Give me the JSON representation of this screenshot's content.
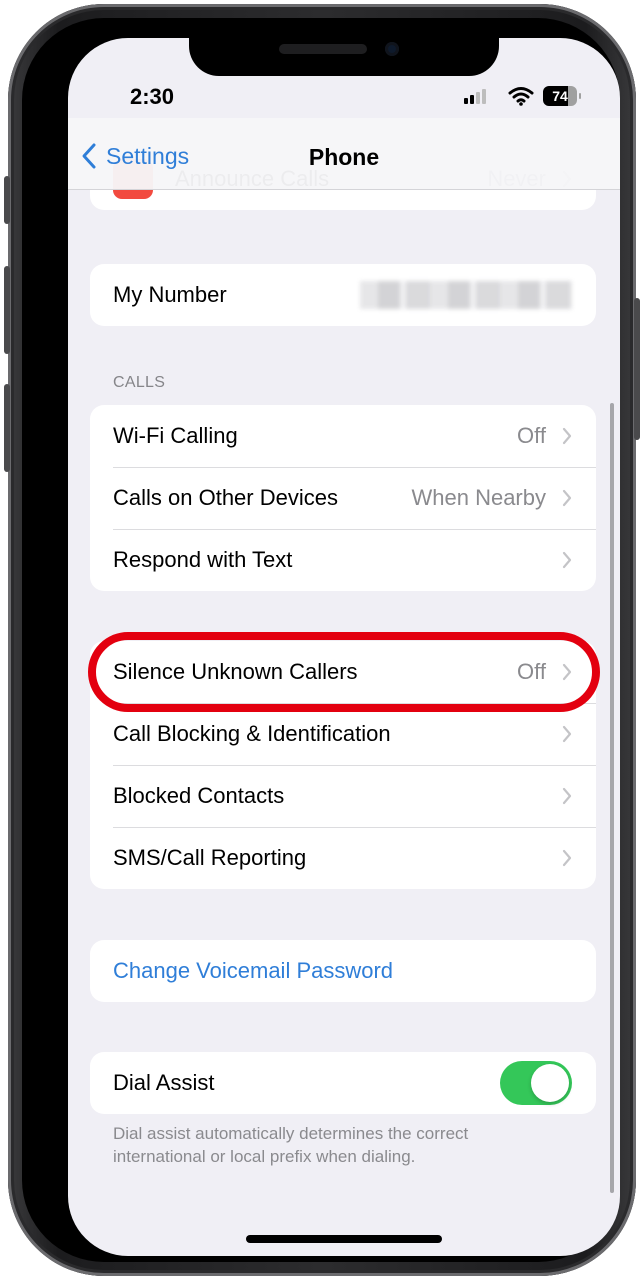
{
  "status_bar": {
    "time": "2:30",
    "battery_level": "74",
    "signal_bars_active": 2,
    "signal_bars_total": 4
  },
  "nav": {
    "back_label": "Settings",
    "title": "Phone"
  },
  "partial_row": {
    "label": "Announce Calls",
    "value": "Never",
    "icon": "red-app-icon"
  },
  "my_number": {
    "label": "My Number",
    "value": "(blurred)"
  },
  "calls_section": {
    "header": "CALLS",
    "rows": [
      {
        "label": "Wi-Fi Calling",
        "value": "Off"
      },
      {
        "label": "Calls on Other Devices",
        "value": "When Nearby"
      },
      {
        "label": "Respond with Text",
        "value": ""
      }
    ]
  },
  "blocking_section": {
    "rows": [
      {
        "label": "Silence Unknown Callers",
        "value": "Off",
        "highlighted": true
      },
      {
        "label": "Call Blocking & Identification",
        "value": ""
      },
      {
        "label": "Blocked Contacts",
        "value": ""
      },
      {
        "label": "SMS/Call Reporting",
        "value": ""
      }
    ]
  },
  "voicemail": {
    "label": "Change Voicemail Password"
  },
  "dial_assist": {
    "label": "Dial Assist",
    "enabled": true,
    "footer": "Dial assist automatically determines the correct international or local prefix when dialing."
  },
  "colors": {
    "accent": "#2f7ed8",
    "toggle_on": "#34c759",
    "highlight_ring": "#e3000f",
    "background": "#f0eff5"
  }
}
